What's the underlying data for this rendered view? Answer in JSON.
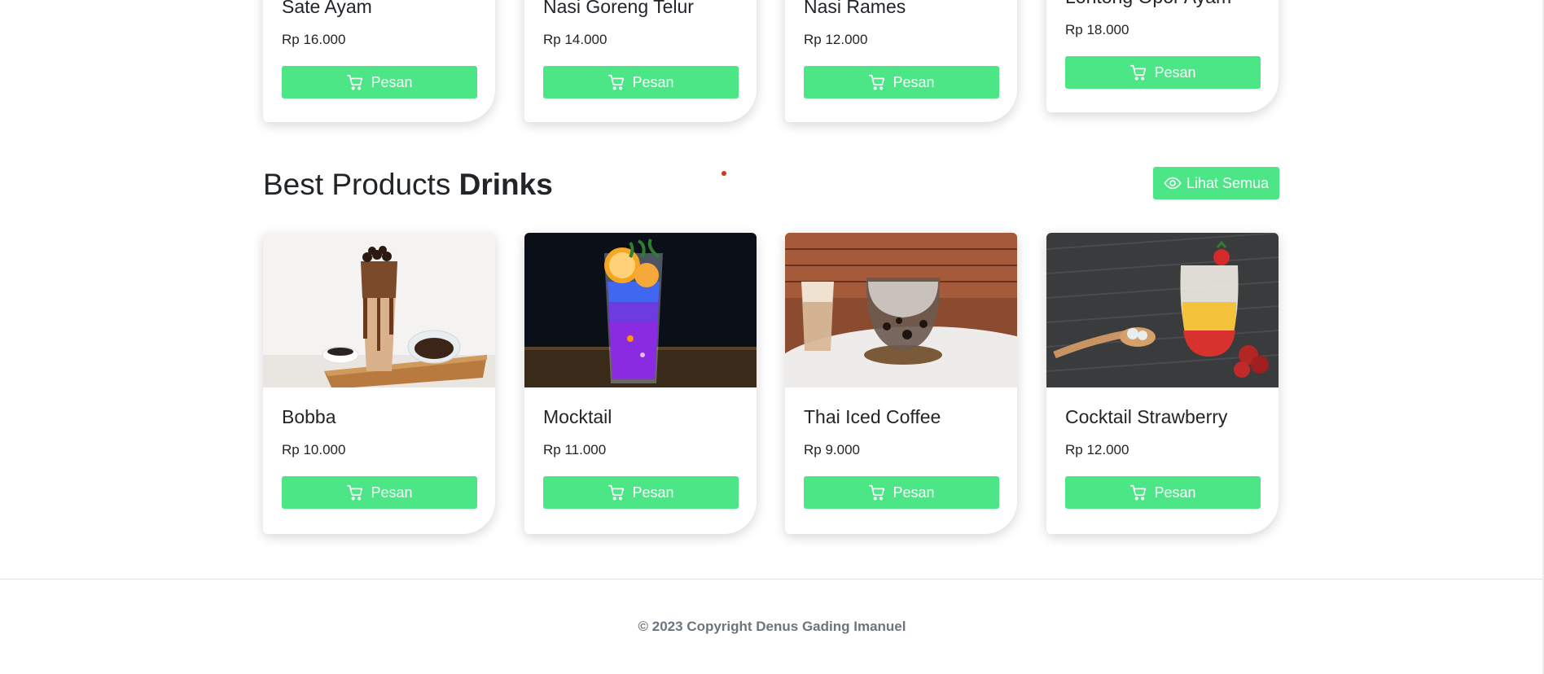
{
  "food_cards": [
    {
      "name": "Sate Ayam",
      "price": "Rp 16.000",
      "button": "Pesan"
    },
    {
      "name": "Nasi Goreng Telur",
      "price": "Rp 14.000",
      "button": "Pesan"
    },
    {
      "name": "Nasi Rames",
      "price": "Rp 12.000",
      "button": "Pesan"
    },
    {
      "name": "Lontong Opor Ayam",
      "price": "Rp 18.000",
      "button": "Pesan"
    }
  ],
  "drinks_section": {
    "title_light": "Best Products",
    "title_bold": "Drinks",
    "view_all_label": "Lihat Semua",
    "cards": [
      {
        "name": "Bobba",
        "price": "Rp 10.000",
        "button": "Pesan"
      },
      {
        "name": "Mocktail",
        "price": "Rp 11.000",
        "button": "Pesan"
      },
      {
        "name": "Thai Iced Coffee",
        "price": "Rp 9.000",
        "button": "Pesan"
      },
      {
        "name": "Cocktail Strawberry",
        "price": "Rp 12.000",
        "button": "Pesan"
      }
    ]
  },
  "footer": {
    "copyright": "© 2023 Copyright Denus Gading Imanuel"
  },
  "colors": {
    "accent": "#4ce686",
    "text": "#212529",
    "muted": "#6c757d"
  },
  "icons": {
    "order_button": "cart-icon",
    "view_all": "eye-icon"
  }
}
